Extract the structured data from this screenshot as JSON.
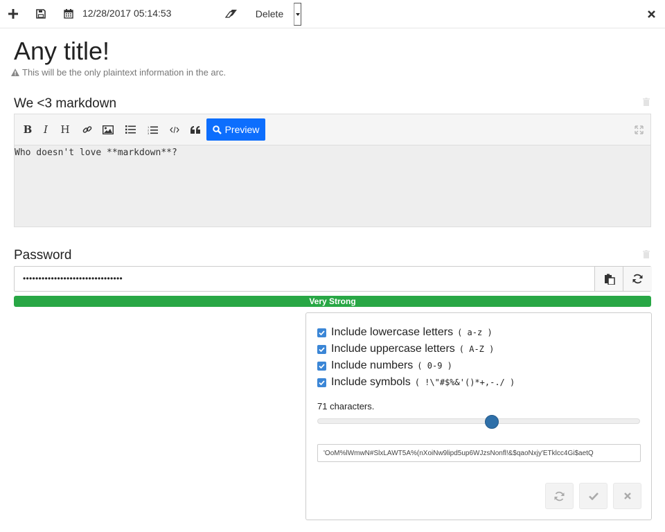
{
  "toolbar": {
    "add_icon": "plus-icon",
    "save_icon": "floppy-disk-icon",
    "calendar_icon": "calendar-icon",
    "date": "12/28/2017 05:14:53",
    "eraser_icon": "eraser-icon",
    "delete_label": "Delete",
    "close_icon": "close-icon"
  },
  "title": "Any title!",
  "hint": "This will be the only plaintext information in the arc.",
  "markdown": {
    "label": "We <3 markdown",
    "tools": [
      "bold-icon",
      "italic-icon",
      "heading-icon",
      "link-icon",
      "image-icon",
      "unordered-list-icon",
      "ordered-list-icon",
      "code-icon",
      "quote-icon"
    ],
    "preview_label": "Preview",
    "content": "Who doesn't love **markdown**?"
  },
  "password": {
    "label": "Password",
    "value": "••••••••••••••••••••••••••••••••",
    "strength": "Very Strong",
    "strength_color": "#28a745"
  },
  "generator": {
    "options": [
      {
        "label": "Include lowercase letters",
        "chars": "( a-z )",
        "checked": true
      },
      {
        "label": "Include uppercase letters",
        "chars": "( A-Z )",
        "checked": true
      },
      {
        "label": "Include numbers",
        "chars": "( 0-9 )",
        "checked": true
      },
      {
        "label": "Include symbols",
        "chars": "( !\\\"#$%&'()*+,-./ )",
        "checked": true
      }
    ],
    "length_text": "71 characters.",
    "slider_fraction": 0.54,
    "generated": "'OoM%lWmwN#SlxLAWT5A%(nXoiNw9lipd5up6WJzsNonfl!&$qaoNxjy'ETklcc4Gi$aetQ"
  },
  "colors": {
    "accent": "#0d6efd",
    "checkbox": "#3b86d6",
    "slider": "#2f70a9"
  }
}
